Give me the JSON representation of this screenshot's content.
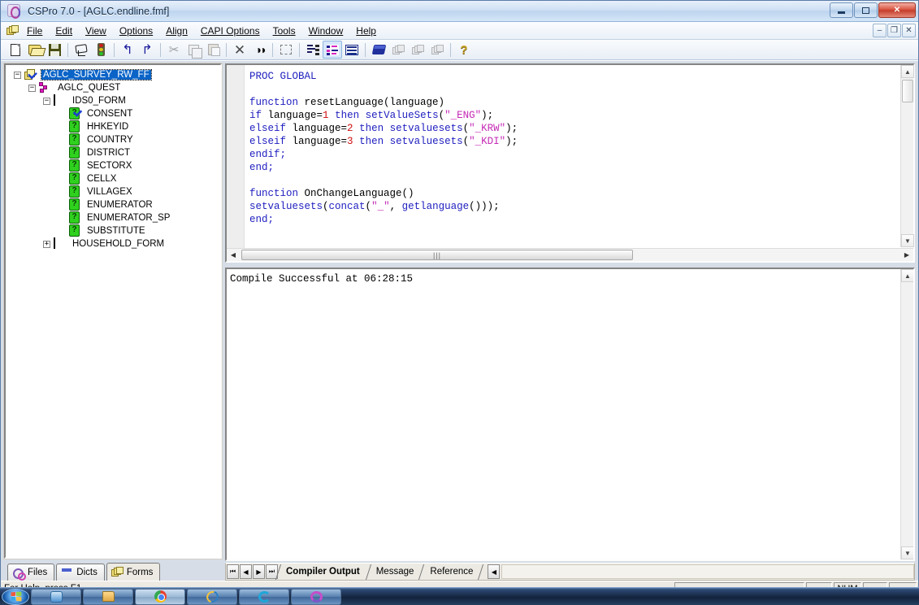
{
  "window": {
    "title": "CSPro 7.0 - [AGLC.endline.fmf]",
    "app_icon": "cspro-icon",
    "controls": {
      "minimize": "–",
      "maximize": "❐",
      "close": "✕"
    },
    "mdi_controls": {
      "minimize": "–",
      "restore": "❐",
      "close": "✕"
    }
  },
  "menubar": {
    "app_icon": "forms-icon",
    "items": [
      {
        "label": "File",
        "accel": "F"
      },
      {
        "label": "Edit",
        "accel": "E"
      },
      {
        "label": "View",
        "accel": "V"
      },
      {
        "label": "Options",
        "accel": "O"
      },
      {
        "label": "Align",
        "accel": "A"
      },
      {
        "label": "CAPI Options",
        "accel": "C"
      },
      {
        "label": "Tools",
        "accel": "T"
      },
      {
        "label": "Window",
        "accel": "W"
      },
      {
        "label": "Help",
        "accel": "H"
      }
    ]
  },
  "toolbar": {
    "buttons": [
      {
        "name": "new-icon",
        "tip": "New"
      },
      {
        "name": "open-icon",
        "tip": "Open"
      },
      {
        "name": "save-icon",
        "tip": "Save"
      },
      {
        "name": "compile-icon",
        "tip": "Compile"
      },
      {
        "name": "traffic-light-icon",
        "tip": "Run"
      },
      {
        "name": "undo-icon",
        "tip": "Undo"
      },
      {
        "name": "redo-icon",
        "tip": "Redo"
      },
      {
        "name": "cut-icon",
        "tip": "Cut"
      },
      {
        "name": "copy-icon",
        "tip": "Copy"
      },
      {
        "name": "paste-icon",
        "tip": "Paste"
      },
      {
        "name": "delete-icon",
        "tip": "Delete"
      },
      {
        "name": "find-icon",
        "tip": "Find"
      },
      {
        "name": "select-region-icon",
        "tip": "Select"
      },
      {
        "name": "properties-list-icon",
        "tip": "Properties"
      },
      {
        "name": "field-properties-icon",
        "tip": "Field Properties"
      },
      {
        "name": "form-view-icon",
        "tip": "Form"
      },
      {
        "name": "dictionary-icon",
        "tip": "Dictionary"
      },
      {
        "name": "forms-stack-icon-1",
        "tip": "Forms"
      },
      {
        "name": "forms-stack-icon-2",
        "tip": "Forms"
      },
      {
        "name": "forms-stack-icon-3",
        "tip": "Forms"
      },
      {
        "name": "help-icon",
        "tip": "Help"
      }
    ]
  },
  "tree": {
    "nodes": [
      {
        "label": "AGLC_SURVEY_RW_FF",
        "icon": "application-icon",
        "indent": 0,
        "expander": "-",
        "selected": true
      },
      {
        "label": "AGLC_QUEST",
        "icon": "level-icon",
        "indent": 1,
        "expander": "-",
        "selected": false
      },
      {
        "label": "IDS0_FORM",
        "icon": "form-icon",
        "indent": 2,
        "expander": "-",
        "selected": false
      },
      {
        "label": "CONSENT",
        "icon": "field-checked-icon",
        "indent": 3,
        "expander": "",
        "selected": false
      },
      {
        "label": "HHKEYID",
        "icon": "field-icon",
        "indent": 3,
        "expander": "",
        "selected": false
      },
      {
        "label": "COUNTRY",
        "icon": "field-icon",
        "indent": 3,
        "expander": "",
        "selected": false
      },
      {
        "label": "DISTRICT",
        "icon": "field-icon",
        "indent": 3,
        "expander": "",
        "selected": false
      },
      {
        "label": "SECTORX",
        "icon": "field-icon",
        "indent": 3,
        "expander": "",
        "selected": false
      },
      {
        "label": "CELLX",
        "icon": "field-icon",
        "indent": 3,
        "expander": "",
        "selected": false
      },
      {
        "label": "VILLAGEX",
        "icon": "field-icon",
        "indent": 3,
        "expander": "",
        "selected": false
      },
      {
        "label": "ENUMERATOR",
        "icon": "field-icon",
        "indent": 3,
        "expander": "",
        "selected": false
      },
      {
        "label": "ENUMERATOR_SP",
        "icon": "field-icon",
        "indent": 3,
        "expander": "",
        "selected": false
      },
      {
        "label": "SUBSTITUTE",
        "icon": "field-icon",
        "indent": 3,
        "expander": "",
        "selected": false
      },
      {
        "label": "HOUSEHOLD_FORM",
        "icon": "form-icon",
        "indent": 2,
        "expander": "+",
        "selected": false
      }
    ]
  },
  "left_tabs": [
    {
      "label": "Files",
      "icon": "files-icon",
      "active": false
    },
    {
      "label": "Dicts",
      "icon": "dicts-icon",
      "active": false
    },
    {
      "label": "Forms",
      "icon": "forms-icon",
      "active": true
    }
  ],
  "editor": {
    "lines": [
      [
        {
          "t": "PROC GLOBAL",
          "c": "kw"
        }
      ],
      [],
      [
        {
          "t": "function",
          "c": "kw"
        },
        {
          "t": " resetLanguage(language)",
          "c": ""
        }
      ],
      [
        {
          "t": "if",
          "c": "kw"
        },
        {
          "t": " language=",
          "c": ""
        },
        {
          "t": "1",
          "c": "num"
        },
        {
          "t": " ",
          "c": ""
        },
        {
          "t": "then",
          "c": "kw"
        },
        {
          "t": " ",
          "c": ""
        },
        {
          "t": "setValueSets",
          "c": "kw"
        },
        {
          "t": "(",
          "c": ""
        },
        {
          "t": "\"_ENG\"",
          "c": "str"
        },
        {
          "t": ");",
          "c": ""
        }
      ],
      [
        {
          "t": "elseif",
          "c": "kw"
        },
        {
          "t": " language=",
          "c": ""
        },
        {
          "t": "2",
          "c": "num"
        },
        {
          "t": " ",
          "c": ""
        },
        {
          "t": "then",
          "c": "kw"
        },
        {
          "t": " ",
          "c": ""
        },
        {
          "t": "setvaluesets",
          "c": "kw"
        },
        {
          "t": "(",
          "c": ""
        },
        {
          "t": "\"_KRW\"",
          "c": "str"
        },
        {
          "t": ");",
          "c": ""
        }
      ],
      [
        {
          "t": "elseif",
          "c": "kw"
        },
        {
          "t": " language=",
          "c": ""
        },
        {
          "t": "3",
          "c": "num"
        },
        {
          "t": " ",
          "c": ""
        },
        {
          "t": "then",
          "c": "kw"
        },
        {
          "t": " ",
          "c": ""
        },
        {
          "t": "setvaluesets",
          "c": "kw"
        },
        {
          "t": "(",
          "c": ""
        },
        {
          "t": "\"_KDI\"",
          "c": "str"
        },
        {
          "t": ");",
          "c": ""
        }
      ],
      [
        {
          "t": "endif;",
          "c": "kw"
        }
      ],
      [
        {
          "t": "end;",
          "c": "kw"
        }
      ],
      [],
      [
        {
          "t": "function",
          "c": "kw"
        },
        {
          "t": " OnChangeLanguage()",
          "c": ""
        }
      ],
      [
        {
          "t": "setvaluesets",
          "c": "kw"
        },
        {
          "t": "(",
          "c": ""
        },
        {
          "t": "concat",
          "c": "kw"
        },
        {
          "t": "(",
          "c": ""
        },
        {
          "t": "\"_\"",
          "c": "str"
        },
        {
          "t": ", ",
          "c": ""
        },
        {
          "t": "getlanguage",
          "c": "kw"
        },
        {
          "t": "()));",
          "c": ""
        }
      ],
      [
        {
          "t": "end;",
          "c": "kw"
        }
      ]
    ],
    "hscroll_grip": "|||"
  },
  "output": {
    "text": "Compile Successful at 06:28:15"
  },
  "bottom_tabs": {
    "nav": [
      "⏮",
      "◀",
      "▶",
      "⏭"
    ],
    "tabs": [
      {
        "label": "Compiler Output",
        "active": true
      },
      {
        "label": "Message",
        "active": false
      },
      {
        "label": "Reference",
        "active": false
      }
    ],
    "scroll_left": "◀"
  },
  "statusbar": {
    "message": "For Help, press F1",
    "panels": [
      "",
      "",
      "NUM",
      "",
      ""
    ]
  },
  "taskbar": {
    "start": "start-orb-icon",
    "buttons": [
      {
        "icon": "explorer-icon",
        "pressed": false
      },
      {
        "icon": "media-icon",
        "pressed": false
      },
      {
        "icon": "chrome-icon",
        "pressed": true
      },
      {
        "icon": "ie-icon",
        "pressed": false
      },
      {
        "icon": "skype-icon",
        "pressed": false
      },
      {
        "icon": "photos-icon",
        "pressed": false
      }
    ]
  },
  "colors": {
    "keyword": "#2020c0",
    "number": "#d01010",
    "string": "#c52bb5",
    "selection": "#0a64c8",
    "close_button": "#c23a27"
  }
}
